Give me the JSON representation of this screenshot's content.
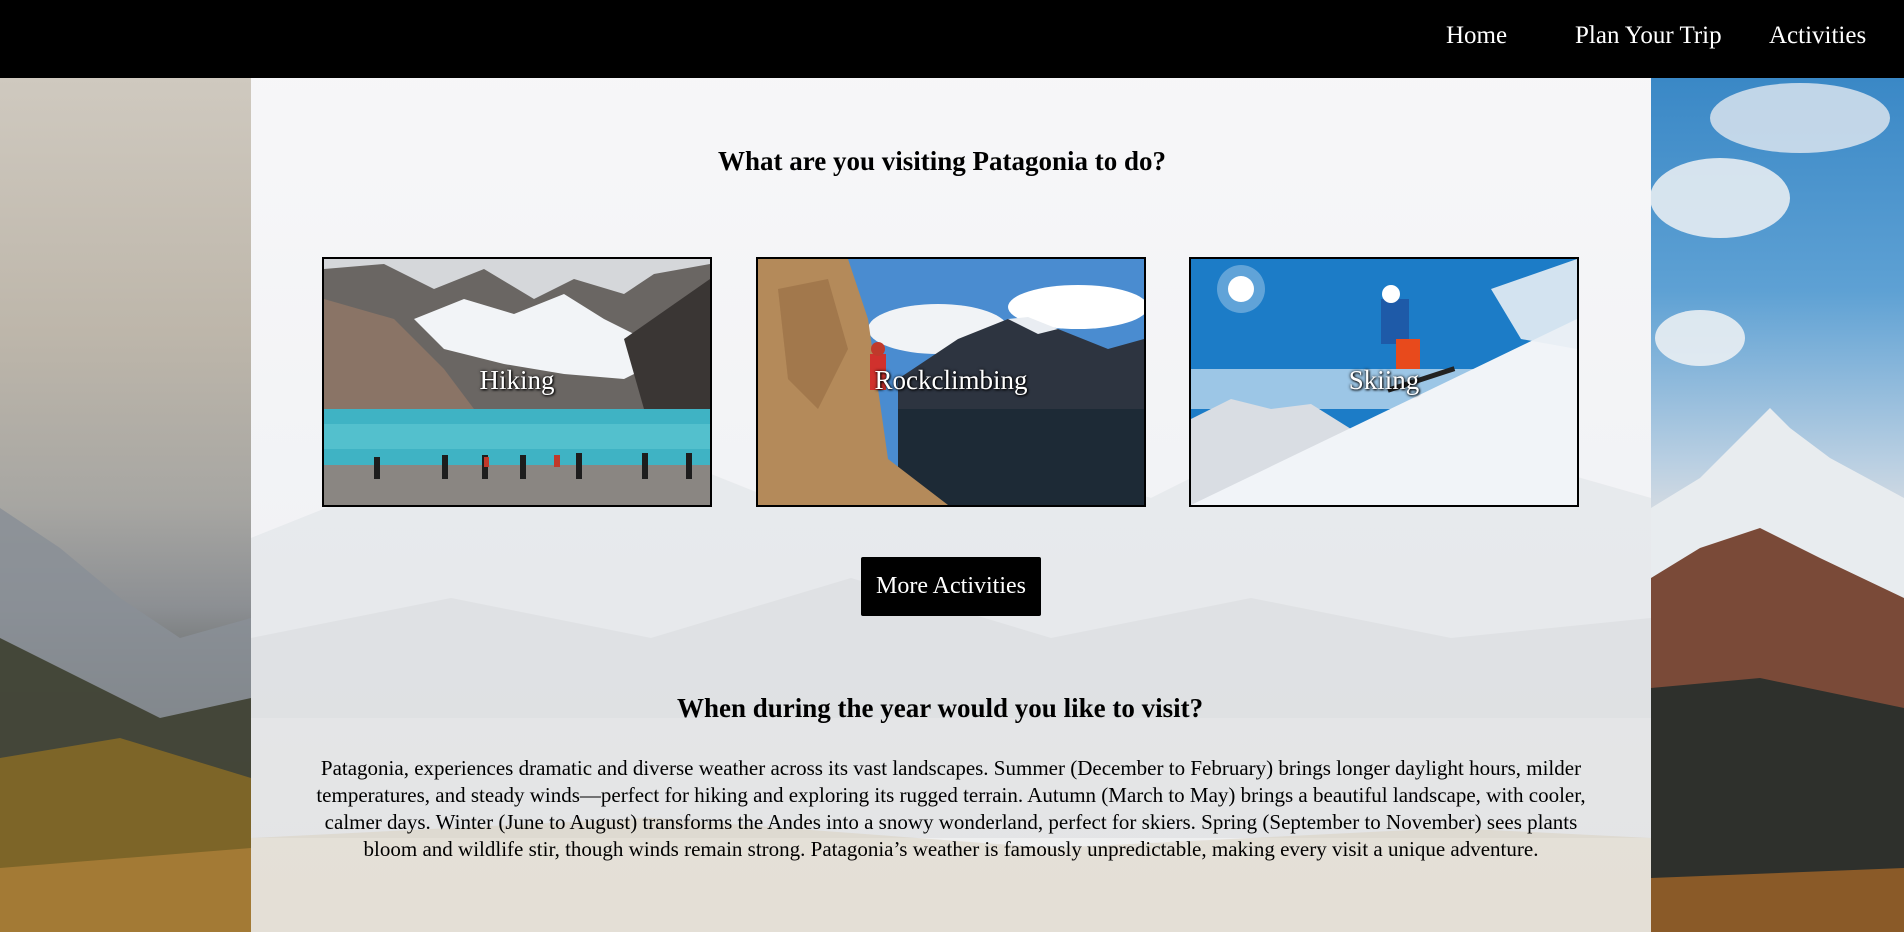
{
  "nav": {
    "home": "Home",
    "plan": "Plan Your Trip",
    "activities": "Activities"
  },
  "activities_section": {
    "heading": "What are you visiting Patagonia to do?",
    "cards": [
      {
        "label": "Hiking",
        "image": "hiking-lake-photo"
      },
      {
        "label": "Rockclimbing",
        "image": "rockclimbing-cliff-photo"
      },
      {
        "label": "Skiing",
        "image": "skiing-slope-photo"
      }
    ],
    "more_button": "More Activities"
  },
  "season_section": {
    "heading": "When during the year would you like to visit?",
    "body": "Patagonia, experiences dramatic and diverse weather across its vast landscapes. Summer (December to February) brings longer daylight hours, milder temperatures, and steady winds—perfect for hiking and exploring its rugged terrain. Autumn (March to May) brings a beautiful landscape, with cooler, calmer days. Winter (June to August) transforms the Andes into a snowy wonderland, perfect for skiers. Spring (September to November) sees plants bloom and wildlife stir, though winds remain strong. Patagonia’s weather is famously unpredictable, making every visit a unique adventure."
  },
  "colors": {
    "nav_bg": "#000000",
    "nav_text": "#ffffff",
    "button_bg": "#000000",
    "button_text": "#ffffff"
  }
}
